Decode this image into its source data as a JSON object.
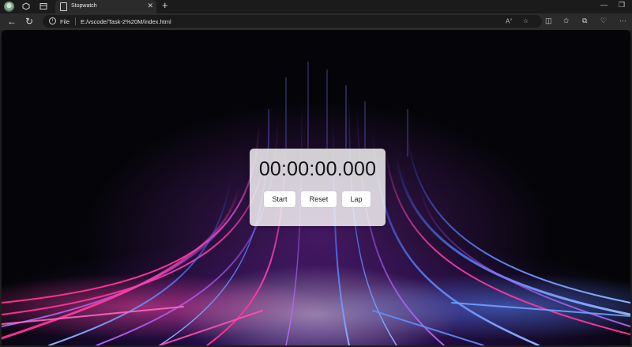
{
  "browser": {
    "tab": {
      "title": "Stopwatch"
    },
    "address": {
      "scheme_label": "File",
      "url": "E:/vscode/Task-2%20M/index.html"
    },
    "icons": {
      "profile": "profile-avatar-icon",
      "workspaces": "workspaces-icon",
      "tab_actions": "tab-actions-icon",
      "tab_favicon": "page-icon",
      "close_tab": "close-icon",
      "new_tab": "plus-icon",
      "back": "back-arrow-icon",
      "refresh": "refresh-icon",
      "info": "info-icon",
      "read_aloud": "read-aloud-icon",
      "favorite": "star-icon",
      "split_screen": "split-screen-icon",
      "favorites": "favorites-icon",
      "collections": "collections-icon",
      "health": "browser-essentials-icon",
      "menu": "more-icon"
    }
  },
  "stopwatch": {
    "time": "00:00:00.000",
    "buttons": {
      "start": "Start",
      "reset": "Reset",
      "lap": "Lap"
    }
  },
  "colors": {
    "chrome_dark": "#1b1b1b",
    "toolbar": "#2b2b2b",
    "page_bg": "#050509",
    "panel": "#ffffffcc",
    "accent_pink": "#ff3fb0",
    "accent_blue": "#4f7cff"
  }
}
